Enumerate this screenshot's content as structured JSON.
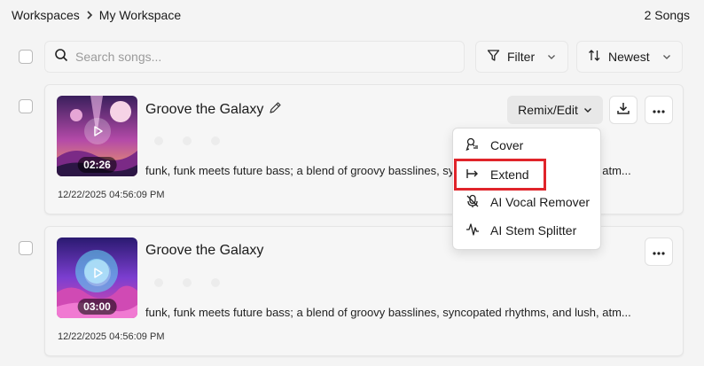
{
  "breadcrumb": {
    "workspaces": "Workspaces",
    "current": "My Workspace"
  },
  "song_count": "2 Songs",
  "search": {
    "placeholder": "Search songs..."
  },
  "filter_label": "Filter",
  "sort_label": "Newest",
  "songs": [
    {
      "title": "Groove the Galaxy",
      "duration": "02:26",
      "description": "funk, funk meets future bass; a blend of groovy basslines, syncopated rhythms, and lush, atm...",
      "date": "12/22/2025 04:56:09 PM",
      "remix_label": "Remix/Edit"
    },
    {
      "title": "Groove the Galaxy",
      "duration": "03:00",
      "description": "funk, funk meets future bass; a blend of groovy basslines, syncopated rhythms, and lush, atm...",
      "date": "12/22/2025 04:56:09 PM"
    }
  ],
  "menu": {
    "items": [
      {
        "label": "Cover",
        "icon": "cover-icon"
      },
      {
        "label": "Extend",
        "icon": "extend-icon",
        "highlighted": true
      },
      {
        "label": "AI Vocal Remover",
        "icon": "vocal-remover-icon"
      },
      {
        "label": "AI Stem Splitter",
        "icon": "stem-splitter-icon"
      }
    ]
  },
  "colors": {
    "highlight": "#e0242a",
    "background": "#f4f4f4",
    "card": "#f6f6f6"
  }
}
